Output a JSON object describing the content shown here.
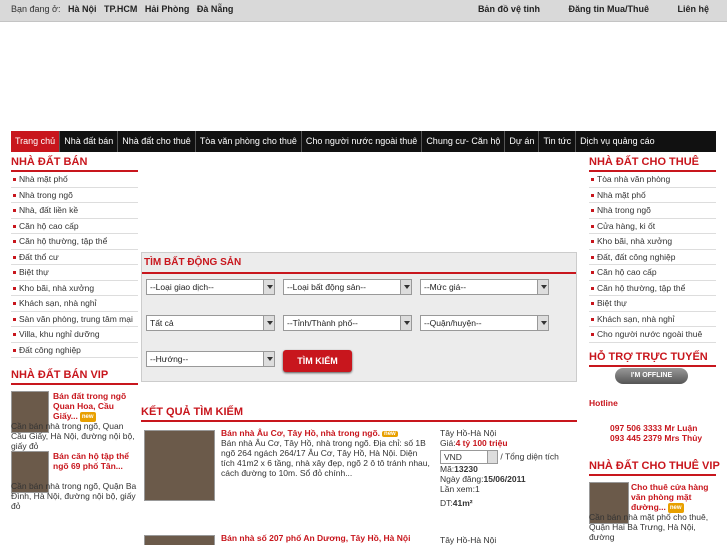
{
  "topbar": {
    "location_prefix": "Bạn đang ở:",
    "cities": [
      "Hà Nội",
      "TP.HCM",
      "Hải Phòng",
      "Đà Nẵng"
    ],
    "links": [
      "Bản đồ vệ tinh",
      "Đăng tin Mua/Thuê",
      "Liên hệ"
    ]
  },
  "nav": [
    "Trang chủ",
    "Nhà đất bán",
    "Nhà đất cho thuê",
    "Tòa văn phòng cho thuê",
    "Cho người nước ngoài thuê",
    "Chung cư- Căn hộ",
    "Dự án",
    "Tin tức",
    "Dịch vụ quảng cáo"
  ],
  "left": {
    "heading": "NHÀ ĐẤT BÁN",
    "items": [
      "Nhà mặt phố",
      "Nhà trong ngõ",
      "Nhà, đất liền kề",
      "Căn hộ cao cấp",
      "Căn hộ thường, tập thể",
      "Đất thổ cư",
      "Biệt thự",
      "Kho bãi, nhà xưởng",
      "Khách sạn, nhà nghỉ",
      "Sàn văn phòng, trung tâm mại",
      "Villa, khu nghỉ dưỡng",
      "Đất công nghiệp"
    ],
    "vip_heading": "NHÀ ĐẤT BÁN VIP",
    "vip": [
      {
        "title": "Bán đất trong ngõ Quan Hoa, Cầu Giấy...",
        "desc": "Cần bán nhà trong ngõ, Quan Cầu Giấy, Hà Nội, đường nội bộ, giấy đỏ"
      },
      {
        "title": "Bán căn hộ tập thể ngõ 69 phố Tân...",
        "desc": "Cần bán nhà trong ngõ, Quận Ba Đình, Hà Nội, đường nội bộ, giấy đỏ"
      }
    ]
  },
  "right": {
    "heading": "NHÀ ĐẤT CHO THUÊ",
    "items": [
      "Tòa nhà văn phòng",
      "Nhà mặt phố",
      "Nhà trong ngõ",
      "Cửa hàng, ki ốt",
      "Kho bãi, nhà xưởng",
      "Đất, đất công nghiệp",
      "Căn hộ cao cấp",
      "Căn hộ thường, tập thể",
      "Biệt thự",
      "Khách sạn, nhà nghỉ",
      "Cho người nước ngoài thuê"
    ],
    "support_heading": "HỖ TRỢ TRỰC TUYẾN",
    "offline": "I'M OFFLINE",
    "hotline": "Hotline",
    "phones": [
      "097 506 3333 Mr Luận",
      "093 445 2379 Mrs Thủy"
    ],
    "vip_heading": "NHÀ ĐẤT CHO THUÊ VIP",
    "vip": {
      "title": "Cho thuê cửa hàng văn phòng mặt đường...",
      "desc": "Cần bán nhà mặt phố cho thuê, Quận Hai Bà Trưng, Hà Nội, đường"
    }
  },
  "search": {
    "title": "TÌM BẤT ĐỘNG SẢN",
    "row1": [
      "--Loại giao dịch--",
      "--Loại bất động sản--",
      "--Mức giá--"
    ],
    "row2": [
      "Tất cả",
      "--Tỉnh/Thành phố--",
      "--Quận/huyện--"
    ],
    "row3": [
      "--Hướng--"
    ],
    "button": "TÌM KIẾM"
  },
  "results": {
    "heading": "KẾT QUẢ TÌM KIẾM",
    "items": [
      {
        "title": "Bán nhà Âu Cơ, Tây Hồ, nhà trong ngõ.",
        "badge": "new",
        "desc": "Bán nhà Âu Cơ, Tây Hồ, nhà trong ngõ. Địa chỉ: số 1B ngõ 264 ngách 264/17 Âu Cơ, Tây Hồ, Hà Nội. Diện tích 41m2 x 6 tầng, nhà xây đẹp, ngõ 2 ô tô tránh nhau, cách đường to 10m. Sổ đỏ chính...",
        "location": "Tây Hồ-Hà Nội",
        "price_label": "Giá:",
        "price": "4 tỷ 100 triệu",
        "currency": "VND",
        "total_area_label": "/ Tổng diện tích",
        "code_label": "Mã:",
        "code": "13230",
        "date_label": "Ngày đăng:",
        "date": "15/06/2011",
        "views_label": "Lần xem:",
        "views": "1",
        "area_label": "DT:",
        "area": "41m²"
      },
      {
        "title": "Bán nhà số 207 phố An Dương, Tây Hồ, Hà Nội",
        "location": "Tây Hồ-Hà Nội"
      }
    ]
  },
  "colors": {
    "accent": "#c8161d",
    "nav_bg": "#111111",
    "topbar_bg": "#d9d9d9"
  }
}
